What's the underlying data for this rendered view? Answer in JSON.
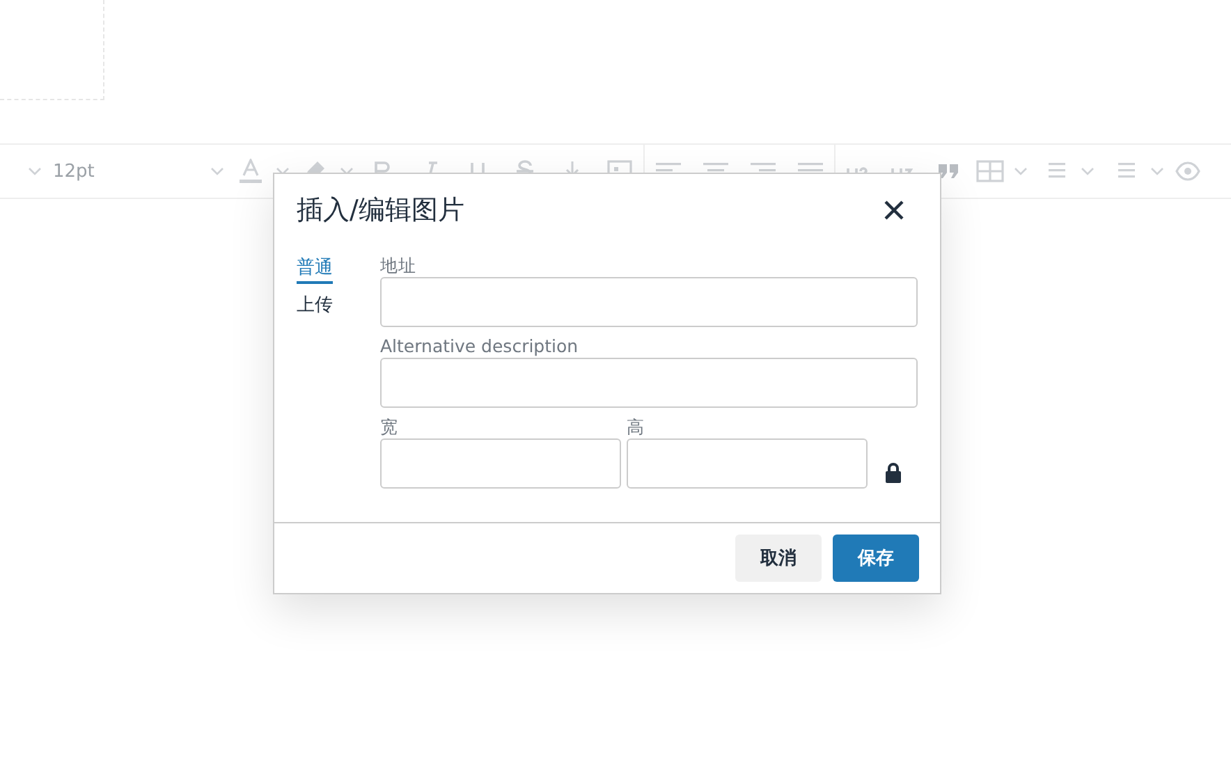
{
  "toolbar": {
    "font_size": "12pt",
    "format_buttons": [
      {
        "kind": "bold"
      },
      {
        "kind": "italic"
      },
      {
        "kind": "underline"
      },
      {
        "kind": "strike"
      }
    ],
    "heading_buttons": [
      {
        "kind": "h2"
      },
      {
        "kind": "h3"
      }
    ]
  },
  "dialog": {
    "title": "插入/编辑图片",
    "tabs": [
      {
        "label": "普通",
        "selected": true
      },
      {
        "label": "上传",
        "selected": false
      }
    ],
    "fields": [
      {
        "label": "地址"
      },
      {
        "label": "Alternative description"
      }
    ],
    "size_fields": [
      {
        "label": "宽"
      },
      {
        "label": "高"
      }
    ],
    "buttons": [
      {
        "label": "取消",
        "kind": "secondary"
      },
      {
        "label": "保存",
        "kind": "primary"
      }
    ]
  }
}
